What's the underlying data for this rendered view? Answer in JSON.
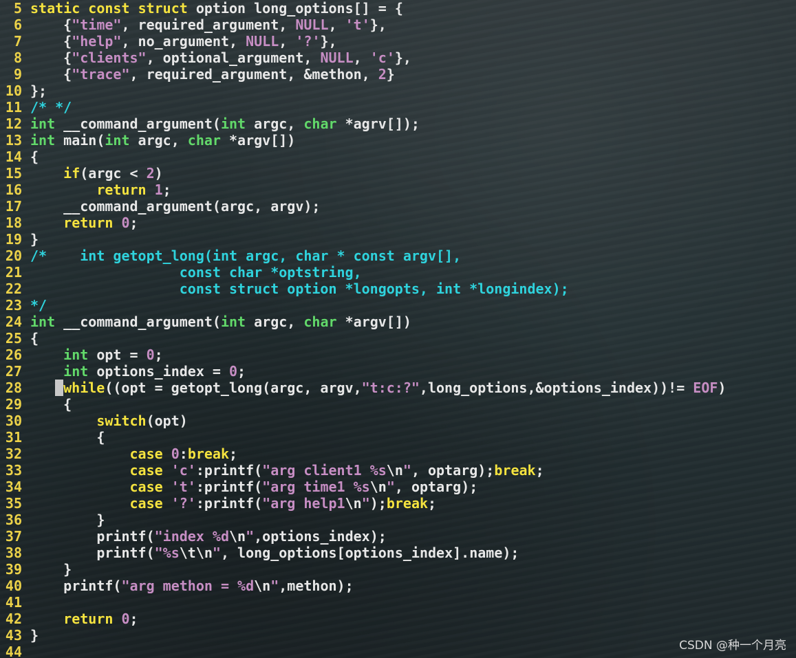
{
  "colors": {
    "line_number": "#ecd249",
    "keyword": "#f5e33f",
    "type": "#62d96a",
    "string": "#c78ec4",
    "number": "#c78ec4",
    "comment": "#2fd3dd",
    "text": "#e8e8e8"
  },
  "watermark": "CSDN @种一个月亮",
  "lines": [
    {
      "n": "5",
      "tokens": [
        [
          "kw",
          "static"
        ],
        [
          "txt",
          " "
        ],
        [
          "kw",
          "const"
        ],
        [
          "txt",
          " "
        ],
        [
          "kw",
          "struct"
        ],
        [
          "txt",
          " option long_options[] = {"
        ]
      ]
    },
    {
      "n": "6",
      "tokens": [
        [
          "txt",
          "    {"
        ],
        [
          "str",
          "\"time\""
        ],
        [
          "txt",
          ", required_argument, "
        ],
        [
          "const",
          "NULL"
        ],
        [
          "txt",
          ", "
        ],
        [
          "str",
          "'t'"
        ],
        [
          "txt",
          "},"
        ]
      ]
    },
    {
      "n": "7",
      "tokens": [
        [
          "txt",
          "    {"
        ],
        [
          "str",
          "\"help\""
        ],
        [
          "txt",
          ", no_argument, "
        ],
        [
          "const",
          "NULL"
        ],
        [
          "txt",
          ", "
        ],
        [
          "str",
          "'?'"
        ],
        [
          "txt",
          "},"
        ]
      ]
    },
    {
      "n": "8",
      "tokens": [
        [
          "txt",
          "    {"
        ],
        [
          "str",
          "\"clients\""
        ],
        [
          "txt",
          ", optional_argument, "
        ],
        [
          "const",
          "NULL"
        ],
        [
          "txt",
          ", "
        ],
        [
          "str",
          "'c'"
        ],
        [
          "txt",
          "},"
        ]
      ]
    },
    {
      "n": "9",
      "tokens": [
        [
          "txt",
          "    {"
        ],
        [
          "str",
          "\"trace\""
        ],
        [
          "txt",
          ", required_argument, &methon, "
        ],
        [
          "num",
          "2"
        ],
        [
          "txt",
          "}"
        ]
      ]
    },
    {
      "n": "10",
      "tokens": [
        [
          "txt",
          "};"
        ]
      ]
    },
    {
      "n": "11",
      "tokens": [
        [
          "cmt",
          "/* */"
        ]
      ]
    },
    {
      "n": "12",
      "tokens": [
        [
          "type",
          "int"
        ],
        [
          "txt",
          " __command_argument("
        ],
        [
          "type",
          "int"
        ],
        [
          "txt",
          " argc, "
        ],
        [
          "type",
          "char"
        ],
        [
          "txt",
          " *agrv[]);"
        ]
      ]
    },
    {
      "n": "13",
      "tokens": [
        [
          "type",
          "int"
        ],
        [
          "txt",
          " main("
        ],
        [
          "type",
          "int"
        ],
        [
          "txt",
          " argc, "
        ],
        [
          "type",
          "char"
        ],
        [
          "txt",
          " *argv[])"
        ]
      ]
    },
    {
      "n": "14",
      "tokens": [
        [
          "txt",
          "{"
        ]
      ]
    },
    {
      "n": "15",
      "tokens": [
        [
          "txt",
          "    "
        ],
        [
          "kw",
          "if"
        ],
        [
          "txt",
          "(argc < "
        ],
        [
          "num",
          "2"
        ],
        [
          "txt",
          ")"
        ]
      ]
    },
    {
      "n": "16",
      "tokens": [
        [
          "txt",
          "        "
        ],
        [
          "kw",
          "return"
        ],
        [
          "txt",
          " "
        ],
        [
          "num",
          "1"
        ],
        [
          "txt",
          ";"
        ]
      ]
    },
    {
      "n": "17",
      "tokens": [
        [
          "txt",
          "    __command_argument(argc, argv);"
        ]
      ]
    },
    {
      "n": "18",
      "tokens": [
        [
          "txt",
          "    "
        ],
        [
          "kw",
          "return"
        ],
        [
          "txt",
          " "
        ],
        [
          "num",
          "0"
        ],
        [
          "txt",
          ";"
        ]
      ]
    },
    {
      "n": "19",
      "tokens": [
        [
          "txt",
          "}"
        ]
      ]
    },
    {
      "n": "20",
      "tokens": [
        [
          "cmt",
          "/*    int getopt_long(int argc, char * const argv[],"
        ]
      ]
    },
    {
      "n": "21",
      "tokens": [
        [
          "cmt",
          "                  const char *optstring,"
        ]
      ]
    },
    {
      "n": "22",
      "tokens": [
        [
          "cmt",
          "                  const struct option *longopts, int *longindex);"
        ]
      ]
    },
    {
      "n": "23",
      "tokens": [
        [
          "cmt",
          "*/"
        ]
      ]
    },
    {
      "n": "24",
      "tokens": [
        [
          "type",
          "int"
        ],
        [
          "txt",
          " __command_argument("
        ],
        [
          "type",
          "int"
        ],
        [
          "txt",
          " argc, "
        ],
        [
          "type",
          "char"
        ],
        [
          "txt",
          " *argv[])"
        ]
      ]
    },
    {
      "n": "25",
      "tokens": [
        [
          "txt",
          "{"
        ]
      ]
    },
    {
      "n": "26",
      "tokens": [
        [
          "txt",
          "    "
        ],
        [
          "type",
          "int"
        ],
        [
          "txt",
          " opt = "
        ],
        [
          "num",
          "0"
        ],
        [
          "txt",
          ";"
        ]
      ]
    },
    {
      "n": "27",
      "tokens": [
        [
          "txt",
          "    "
        ],
        [
          "type",
          "int"
        ],
        [
          "txt",
          " options_index = "
        ],
        [
          "num",
          "0"
        ],
        [
          "txt",
          ";"
        ]
      ]
    },
    {
      "n": "28",
      "tokens": [
        [
          "txt",
          "   "
        ],
        [
          "cursor",
          " "
        ],
        [
          "kw",
          "while"
        ],
        [
          "txt",
          "((opt = getopt_long(argc, argv,"
        ],
        [
          "str",
          "\"t:c:?\""
        ],
        [
          "txt",
          ",long_options,&options_index))!= "
        ],
        [
          "const",
          "EOF"
        ],
        [
          "txt",
          ")"
        ]
      ]
    },
    {
      "n": "29",
      "tokens": [
        [
          "txt",
          "    {"
        ]
      ]
    },
    {
      "n": "30",
      "tokens": [
        [
          "txt",
          "        "
        ],
        [
          "kw",
          "switch"
        ],
        [
          "txt",
          "(opt)"
        ]
      ]
    },
    {
      "n": "31",
      "tokens": [
        [
          "txt",
          "        {"
        ]
      ]
    },
    {
      "n": "32",
      "tokens": [
        [
          "txt",
          "            "
        ],
        [
          "kw",
          "case"
        ],
        [
          "txt",
          " "
        ],
        [
          "num",
          "0"
        ],
        [
          "txt",
          ":"
        ],
        [
          "kw",
          "break"
        ],
        [
          "txt",
          ";"
        ]
      ]
    },
    {
      "n": "33",
      "tokens": [
        [
          "txt",
          "            "
        ],
        [
          "kw",
          "case"
        ],
        [
          "txt",
          " "
        ],
        [
          "str",
          "'c'"
        ],
        [
          "txt",
          ":printf("
        ],
        [
          "str",
          "\"arg client1 %s"
        ],
        [
          "esc",
          "\\n"
        ],
        [
          "str",
          "\""
        ],
        [
          "txt",
          ", optarg);"
        ],
        [
          "kw",
          "break"
        ],
        [
          "txt",
          ";"
        ]
      ]
    },
    {
      "n": "34",
      "tokens": [
        [
          "txt",
          "            "
        ],
        [
          "kw",
          "case"
        ],
        [
          "txt",
          " "
        ],
        [
          "str",
          "'t'"
        ],
        [
          "txt",
          ":printf("
        ],
        [
          "str",
          "\"arg time1 %s"
        ],
        [
          "esc",
          "\\n"
        ],
        [
          "str",
          "\""
        ],
        [
          "txt",
          ", optarg);"
        ]
      ]
    },
    {
      "n": "35",
      "tokens": [
        [
          "txt",
          "            "
        ],
        [
          "kw",
          "case"
        ],
        [
          "txt",
          " "
        ],
        [
          "str",
          "'?'"
        ],
        [
          "txt",
          ":printf("
        ],
        [
          "str",
          "\"arg help1"
        ],
        [
          "esc",
          "\\n"
        ],
        [
          "str",
          "\""
        ],
        [
          "txt",
          ");"
        ],
        [
          "kw",
          "break"
        ],
        [
          "txt",
          ";"
        ]
      ]
    },
    {
      "n": "36",
      "tokens": [
        [
          "txt",
          "        }"
        ]
      ]
    },
    {
      "n": "37",
      "tokens": [
        [
          "txt",
          "        printf("
        ],
        [
          "str",
          "\"index %d"
        ],
        [
          "esc",
          "\\n"
        ],
        [
          "str",
          "\""
        ],
        [
          "txt",
          ",options_index);"
        ]
      ]
    },
    {
      "n": "38",
      "tokens": [
        [
          "txt",
          "        printf("
        ],
        [
          "str",
          "\"%s"
        ],
        [
          "esc",
          "\\t\\n"
        ],
        [
          "str",
          "\""
        ],
        [
          "txt",
          ", long_options[options_index].name);"
        ]
      ]
    },
    {
      "n": "39",
      "tokens": [
        [
          "txt",
          "    }"
        ]
      ]
    },
    {
      "n": "40",
      "tokens": [
        [
          "txt",
          "    printf("
        ],
        [
          "str",
          "\"arg methon = %d"
        ],
        [
          "esc",
          "\\n"
        ],
        [
          "str",
          "\""
        ],
        [
          "txt",
          ",methon);"
        ]
      ]
    },
    {
      "n": "41",
      "tokens": []
    },
    {
      "n": "42",
      "tokens": [
        [
          "txt",
          "    "
        ],
        [
          "kw",
          "return"
        ],
        [
          "txt",
          " "
        ],
        [
          "num",
          "0"
        ],
        [
          "txt",
          ";"
        ]
      ]
    },
    {
      "n": "43",
      "tokens": [
        [
          "txt",
          "}"
        ]
      ]
    },
    {
      "n": "44",
      "tokens": []
    }
  ]
}
